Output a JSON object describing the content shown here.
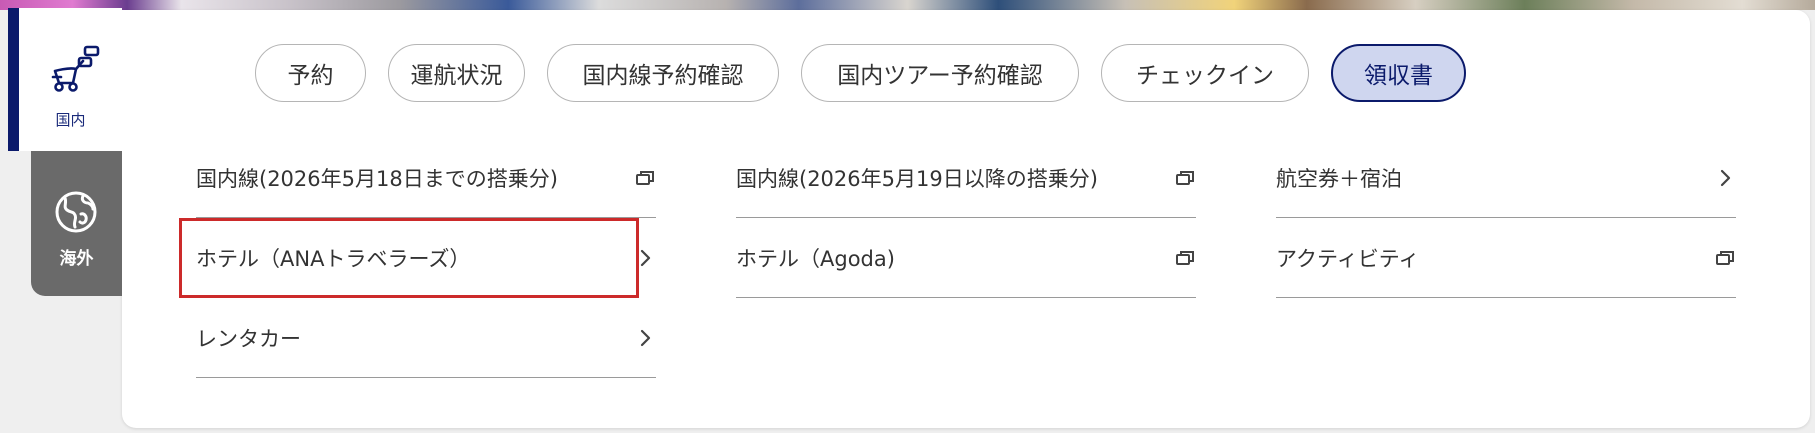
{
  "side_tabs": {
    "domestic": {
      "label": "国内",
      "icon": "airline-seat-icon"
    },
    "overseas": {
      "label": "海外",
      "icon": "globe-icon"
    }
  },
  "top_tabs": [
    {
      "label": "予約",
      "active": false
    },
    {
      "label": "運航状況",
      "active": false
    },
    {
      "label": "国内線予約確認",
      "active": false
    },
    {
      "label": "国内ツアー予約確認",
      "active": false
    },
    {
      "label": "チェックイン",
      "active": false
    },
    {
      "label": "領収書",
      "active": true
    }
  ],
  "links": [
    {
      "label": "国内線(2026年5月18日までの搭乗分)",
      "icon": "external-window-icon"
    },
    {
      "label": "国内線(2026年5月19日以降の搭乗分)",
      "icon": "external-window-icon"
    },
    {
      "label": "航空券＋宿泊",
      "icon": "chevron-right-icon"
    },
    {
      "label": "ホテル（ANAトラベラーズ）",
      "icon": "chevron-right-icon",
      "highlighted": true
    },
    {
      "label": "ホテル（Agoda)",
      "icon": "external-window-icon"
    },
    {
      "label": "アクティビティ",
      "icon": "external-window-icon"
    },
    {
      "label": "レンタカー",
      "icon": "chevron-right-icon"
    }
  ],
  "colors": {
    "brand_navy": "#0b1a6b",
    "active_tab_bg": "#cfd6ef",
    "highlight_red": "#cc2a2a",
    "overseas_tab_bg": "#6a6a6a"
  }
}
